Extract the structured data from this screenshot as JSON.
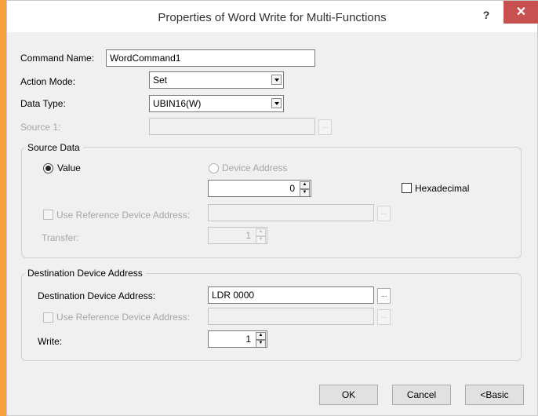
{
  "window": {
    "title": "Properties of Word Write for Multi-Functions",
    "help_label": "?",
    "close_label": "✕"
  },
  "command_name": {
    "label": "Command Name:",
    "value": "WordCommand1"
  },
  "action_mode": {
    "label": "Action Mode:",
    "value": "Set"
  },
  "data_type": {
    "label": "Data Type:",
    "value": "UBIN16(W)"
  },
  "source1": {
    "label": "Source 1:",
    "value": ""
  },
  "browse_label": "...",
  "source_data": {
    "title": "Source Data",
    "value_radio": "Value",
    "device_address_radio": "Device Address",
    "value": "0",
    "hexadecimal": "Hexadecimal",
    "use_ref_label": "Use Reference Device Address:",
    "use_ref_value": "",
    "transfer_label": "Transfer:",
    "transfer_value": "1"
  },
  "destination": {
    "title": "Destination Device Address",
    "address_label": "Destination Device Address:",
    "address_value": "LDR 0000",
    "use_ref_label": "Use Reference Device Address:",
    "use_ref_value": "",
    "write_label": "Write:",
    "write_value": "1"
  },
  "buttons": {
    "ok": "OK",
    "cancel": "Cancel",
    "basic": "<Basic"
  },
  "colors": {
    "background": "#f6a23c",
    "close": "#c75050",
    "dialog": "#f0f0f0"
  }
}
